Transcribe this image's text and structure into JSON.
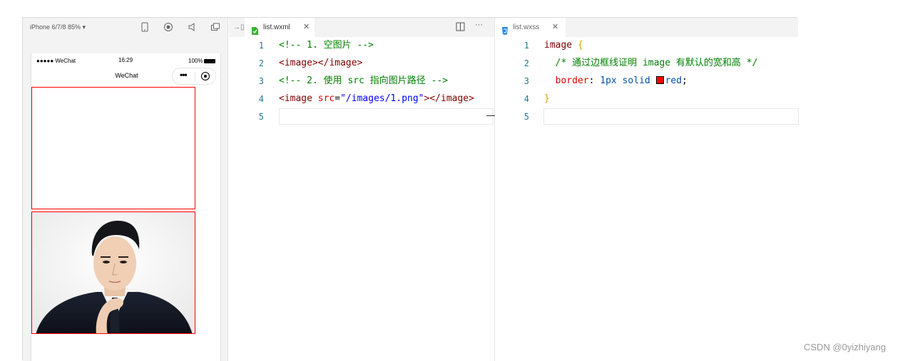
{
  "simulator": {
    "device": "iPhone 6/7/8 85% ▾",
    "status": {
      "carrier": "●●●●● WeChat",
      "time": "16:29",
      "battery": "100%"
    },
    "nav_title": "WeChat"
  },
  "tabs": {
    "wxml": {
      "name": "list.wxml"
    },
    "wxss": {
      "name": "list.wxss"
    }
  },
  "wxml_code": [
    {
      "n": "1",
      "parts": [
        {
          "c": "c-comment",
          "t": "<!-- 1. 空图片 -->"
        }
      ]
    },
    {
      "n": "2",
      "parts": [
        {
          "c": "c-tag",
          "t": "<image></image>"
        }
      ]
    },
    {
      "n": "3",
      "parts": [
        {
          "c": "c-comment",
          "t": "<!-- 2. 使用 src 指向图片路径 -->"
        }
      ]
    },
    {
      "n": "4",
      "parts": [
        {
          "c": "c-tag",
          "t": "<image "
        },
        {
          "c": "c-attr",
          "t": "src"
        },
        {
          "c": "c-plain",
          "t": "="
        },
        {
          "c": "c-str",
          "t": "\"/images/1.png\""
        },
        {
          "c": "c-tag",
          "t": "></image>"
        }
      ]
    },
    {
      "n": "5",
      "parts": []
    }
  ],
  "wxss_code": [
    {
      "n": "1",
      "parts": [
        {
          "c": "c-sel",
          "t": "image "
        },
        {
          "c": "c-brace",
          "t": "{"
        }
      ]
    },
    {
      "n": "2",
      "parts": [
        {
          "c": "c-comment",
          "t": "  /* 通过边框线证明 image 有默认的宽和高 */"
        }
      ]
    },
    {
      "n": "3",
      "parts": [
        {
          "c": "c-prop",
          "t": "  border"
        },
        {
          "c": "c-plain",
          "t": ": "
        },
        {
          "c": "c-val",
          "t": "1px solid "
        },
        {
          "c": "swatch",
          "t": ""
        },
        {
          "c": "c-val",
          "t": "red"
        },
        {
          "c": "c-plain",
          "t": ";"
        }
      ]
    },
    {
      "n": "4",
      "parts": [
        {
          "c": "c-brace",
          "t": "}"
        }
      ]
    },
    {
      "n": "5",
      "parts": []
    }
  ],
  "watermark": "CSDN @0yizhiyang",
  "colors": {
    "border_red": "#ff0000",
    "wxml_icon": "#3cb034",
    "wxss_icon": "#1e88e5"
  }
}
